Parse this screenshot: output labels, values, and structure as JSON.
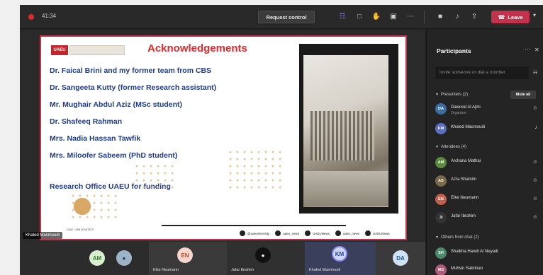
{
  "topbar": {
    "timer": "41:34",
    "request_control": "Request control",
    "leave": "Leave",
    "icons": [
      "people-icon",
      "chat-icon",
      "raise-hand-icon",
      "rooms-icon",
      "more-icon",
      "camera-icon",
      "mic-icon",
      "share-icon"
    ]
  },
  "slide": {
    "logo_text": "UAEU",
    "title": "Acknowledgements",
    "lines": [
      "Dr. Faical Brini and my former team from CBS",
      "Dr. Sangeeta Kutty (former Research assistant)",
      "Mr. Mughair Abdul Aziz (MSc student)",
      "Dr. Shafeeq Rahman",
      "Mrs. Nadia Hassan Tawfik",
      "Mrs. Miloofer Sabeem (PhD student)",
      "Research Office UAEU for funding"
    ],
    "uae_label": "UAE INNOVATES",
    "socials": [
      "@uaeuniversity",
      "uaeu_news",
      "UAEUNews",
      "uaeu_news",
      "UAEUNews"
    ]
  },
  "presenter_label": "Khaled Masmoudi",
  "tiles": [
    {
      "initials": "AM",
      "name": "",
      "color": "#d8f0d0",
      "fg": "#3a7a2a"
    },
    {
      "initials": "",
      "name": "",
      "color": "#9fb3c8",
      "fg": "#1f3a55"
    },
    {
      "initials": "EN",
      "name": "Elke Neumann",
      "color": "#f6d6cc",
      "fg": "#b44a2a"
    },
    {
      "initials": "",
      "name": "Jafar Ibrahim",
      "color": "#222222",
      "fg": "#ffffff"
    },
    {
      "initials": "KM",
      "name": "Khaled Masmoudi",
      "color": "#cfd8f6",
      "fg": "#2a3fa0"
    },
    {
      "initials": "DA",
      "name": "",
      "color": "#cfe3f6",
      "fg": "#1f5a9a"
    }
  ],
  "panel": {
    "title": "Participants",
    "search_placeholder": "Invite someone or dial a number",
    "presenters_header": "Presenters (2)",
    "mute_all": "Mute all",
    "presenters": [
      {
        "initials": "DA",
        "name": "Dawood Al Ajmi",
        "role": "Organizer",
        "color": "#3a6ea5"
      },
      {
        "initials": "KM",
        "name": "Khaled Masmoudi",
        "role": "",
        "color": "#5a6fc0"
      }
    ],
    "attendees_header": "Attendees (4)",
    "attendees": [
      {
        "initials": "AM",
        "name": "Archana Mathai",
        "color": "#5a8a3a"
      },
      {
        "initials": "AS",
        "name": "Azra Shamim",
        "color": "#7a6a4a"
      },
      {
        "initials": "EN",
        "name": "Elke Neumann",
        "color": "#c0604a"
      },
      {
        "initials": "JI",
        "name": "Jafar Ibrahim",
        "color": "#333333"
      }
    ],
    "others_header": "Others from chat (2)",
    "others": [
      {
        "initials": "SH",
        "name": "Shaikha Hareb Al Neyadi",
        "color": "#4a8a6a"
      },
      {
        "initials": "MS",
        "name": "Muhsin Sabrinan",
        "color": "#b05a7a"
      }
    ]
  }
}
